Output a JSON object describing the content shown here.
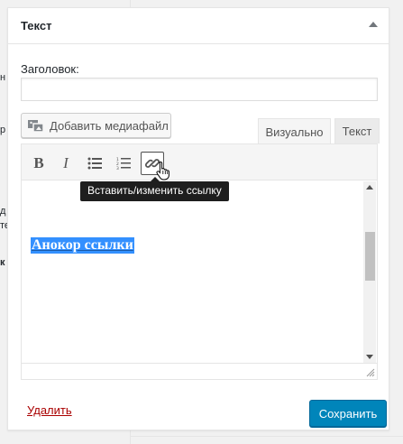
{
  "background": {
    "fragments": [
      "н",
      "р",
      "д",
      "те",
      "к"
    ]
  },
  "widget": {
    "title": "Текст",
    "field_label": "Заголовок:",
    "title_value": "",
    "media_button_label": "Добавить медиафайл",
    "tabs": [
      {
        "label": "Визуально",
        "active": true
      },
      {
        "label": "Текст",
        "active": false
      }
    ],
    "toolbar": {
      "bold_label": "B",
      "italic_label": "I",
      "icons": [
        "bold-icon",
        "italic-icon",
        "bulleted-list-icon",
        "numbered-list-icon",
        "link-icon"
      ]
    },
    "tooltip": "Вставить/изменить ссылку",
    "content_text": "Анокор ссылки",
    "delete_label": "Удалить",
    "save_label": "Сохранить"
  },
  "colors": {
    "accent": "#0085ba",
    "selection": "#3390ff",
    "delete": "#aa0000"
  }
}
